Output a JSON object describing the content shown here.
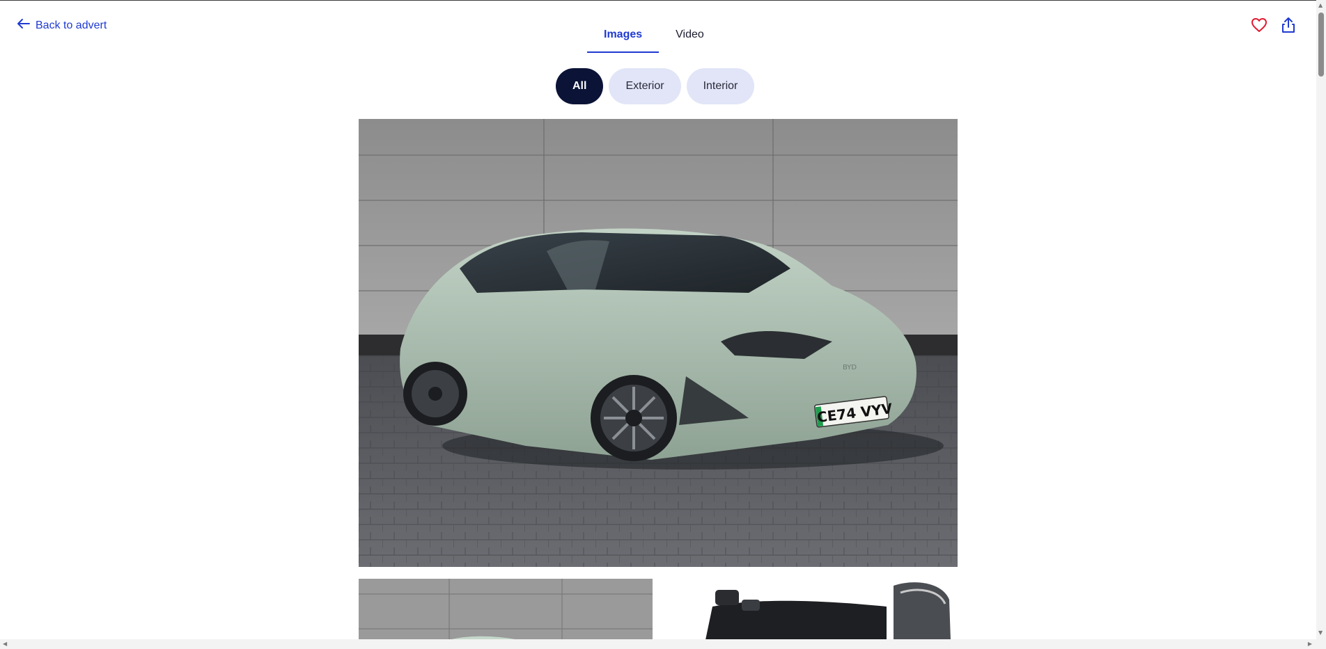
{
  "header": {
    "back_label": "Back to advert",
    "tabs": [
      {
        "label": "Images",
        "active": true
      },
      {
        "label": "Video",
        "active": false
      }
    ],
    "actions": [
      {
        "icon": "heart-icon",
        "color": "#e0182d"
      },
      {
        "icon": "share-icon",
        "color": "#1f3ad1"
      }
    ]
  },
  "filters": [
    {
      "label": "All",
      "active": true
    },
    {
      "label": "Exterior",
      "active": false
    },
    {
      "label": "Interior",
      "active": false
    }
  ],
  "gallery": {
    "main_image": {
      "plate": "CE74 VYV",
      "badge": "BYD"
    }
  },
  "colors": {
    "accent": "#1f3ad1",
    "chip_active": "#0b1437",
    "chip": "#e1e5f7"
  }
}
